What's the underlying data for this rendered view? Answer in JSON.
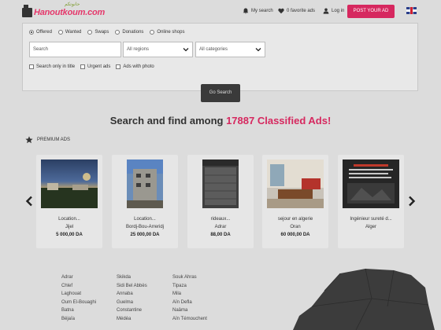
{
  "header": {
    "logo_text": "Hanoutkoum.com",
    "logo_arabic": "حانوتكم",
    "my_search": "My search",
    "favorites": "0 favorite ads",
    "login": "Log in",
    "post_ad": "POST YOUR AD"
  },
  "search": {
    "radio_options": [
      {
        "label": "Offered",
        "checked": true
      },
      {
        "label": "Wanted",
        "checked": false
      },
      {
        "label": "Swaps",
        "checked": false
      },
      {
        "label": "Donations",
        "checked": false
      },
      {
        "label": "Online shops",
        "checked": false
      }
    ],
    "query_placeholder": "Search",
    "regions_value": "All regions",
    "categories_value": "All categories",
    "check_title": "Search only in title",
    "check_urgent": "Urgent ads",
    "check_photo": "Ads with photo",
    "go_label": "Go Search"
  },
  "headline": {
    "before": "Search and find among ",
    "count": "17887 Classified Ads!"
  },
  "premium": {
    "label": "PREMIUM ADS",
    "cards": [
      {
        "title": "Location...",
        "location": "Jijel",
        "price": "5 000,00 DA"
      },
      {
        "title": "Location...",
        "location": "Bordj-Bou-Arreridj",
        "price": "25 000,00 DA"
      },
      {
        "title": "rideaux...",
        "location": "Adrar",
        "price": "88,00 DA"
      },
      {
        "title": "sejour en algerie",
        "location": "Oran",
        "price": "60 000,00 DA"
      },
      {
        "title": "Ingénieur sureté d...",
        "location": "Alger",
        "price": ""
      }
    ]
  },
  "regions": {
    "col1": [
      "Adrar",
      "Chlef",
      "Laghouat",
      "Oum El-Bouaghi",
      "Batna",
      "Béjaïa"
    ],
    "col2": [
      "Skikda",
      "Sidi Bel Abbès",
      "Annaba",
      "Guelma",
      "Constantine",
      "Médéa"
    ],
    "col3": [
      "Souk Ahras",
      "Tipaza",
      "Mila",
      "Aïn Defla",
      "Naâma",
      "Aïn Témouchent"
    ]
  },
  "colors": {
    "accent": "#d6285f",
    "page_bg": "#dcdcdc"
  }
}
